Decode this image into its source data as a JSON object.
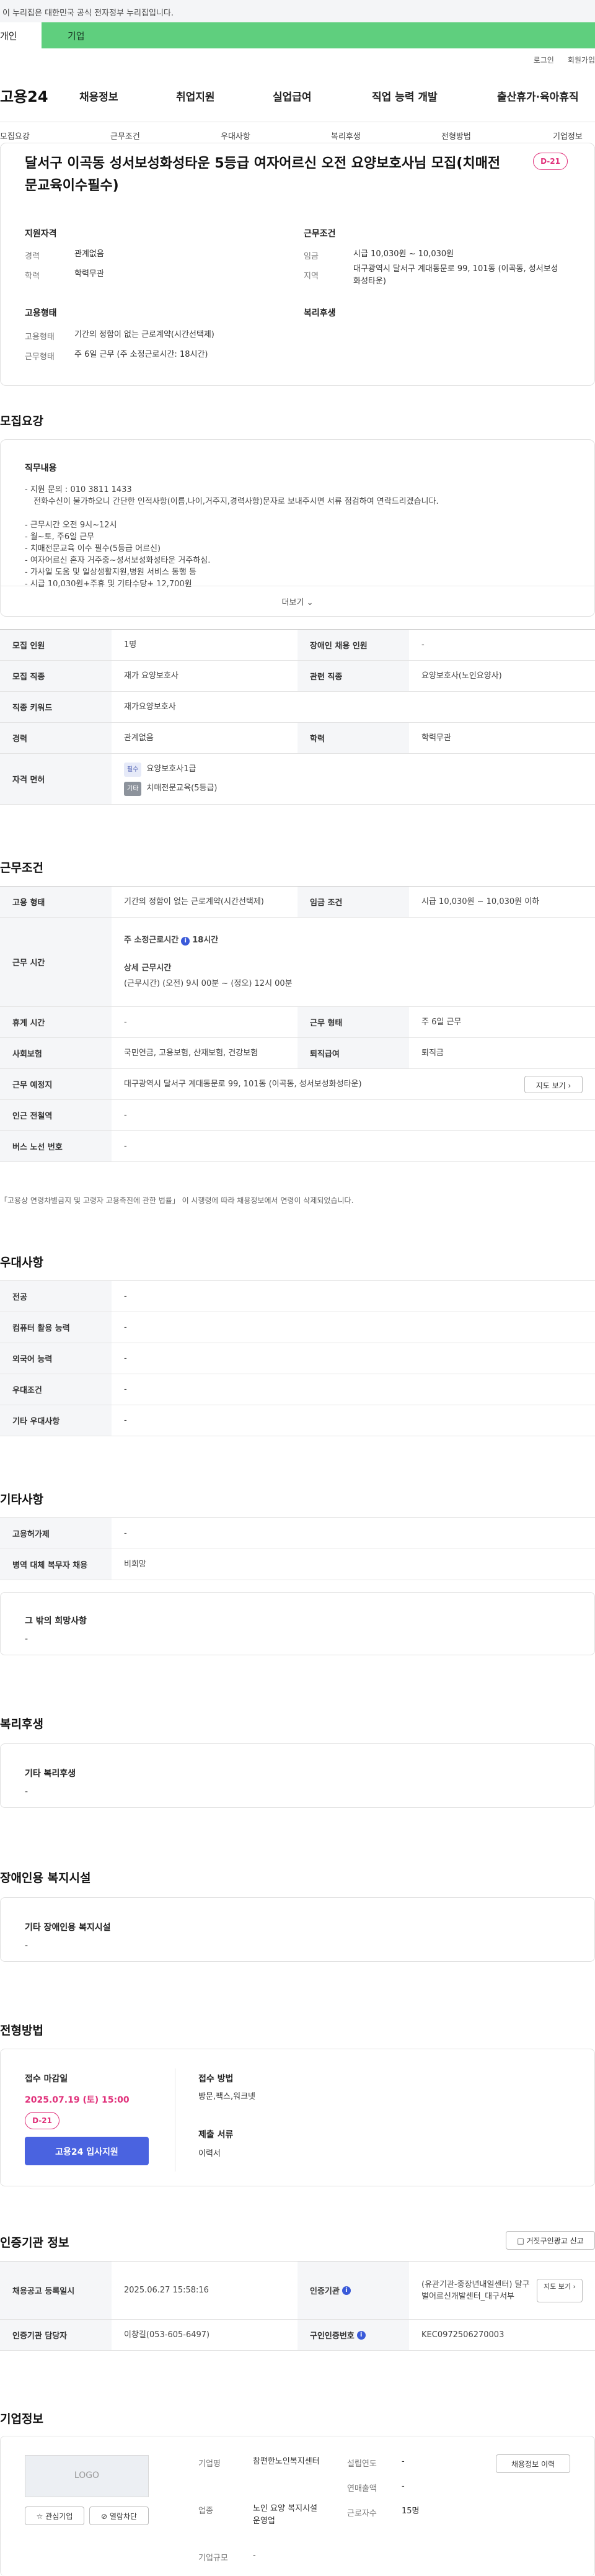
{
  "gov_banner": "이 누리집은 대한민국 공식 전자정부 누리집입니다.",
  "top_tabs": {
    "personal": "개인",
    "company": "기업"
  },
  "util": {
    "login": "로그인",
    "join": "회원가입"
  },
  "logo": "고용24",
  "gnb": [
    "채용정보",
    "취업지원",
    "실업급여",
    "직업 능력 개발",
    "출산휴가·육아휴직"
  ],
  "subnav": [
    "모집요강",
    "근무조건",
    "우대사항",
    "복리후생",
    "전형방법",
    "기업정보"
  ],
  "job": {
    "title": "달서구 이곡동 성서보성화성타운 5등급 여자어르신 오전 요양보호사님 모집(치매전문교육이수필수)",
    "dday": "D-21",
    "qual_h": "지원자격",
    "qual": [
      [
        "경력",
        "관계없음"
      ],
      [
        "학력",
        "학력무관"
      ]
    ],
    "cond_h": "근무조건",
    "cond": [
      [
        "임금",
        "시급 10,030원 ~ 10,030원"
      ],
      [
        "지역",
        "대구광역시 달서구 계대동문로 99, 101동 (이곡동, 성서보성화성타운)"
      ]
    ],
    "emp_h": "고용형태",
    "emp": [
      [
        "고용형태",
        "기간의 정함이 없는 근로계약(시간선택제)"
      ],
      [
        "근무형태",
        "주 6일 근무 (주 소정근로시간: 18시간)"
      ]
    ],
    "welfare_h": "복리후생"
  },
  "recruit": {
    "heading": "모집요강",
    "duty_h": "직무내용",
    "duty_lines": [
      "- 지원 문의 : 010 3811 1433",
      "  전화수신이 불가하오니 간단한 인적사항(이름,나이,거주지,경력사항)문자로 보내주시면 서류 점검하여 연락드리겠습니다.",
      "",
      "- 근무시간 오전 9시~12시",
      "- 월~토, 주6일 근무",
      "- 치매전문교육 이수 필수(5등급 어르신)",
      "- 여자어르신 혼자 거주중~성서보성화성타운 거주하심.",
      "- 가사일 도움 및 일상생활지원,병원 서비스 동행 등",
      "- 시급 10,030원+주휴 및 기타수당+ 12,700원"
    ],
    "more": "더보기",
    "rows": [
      {
        "k1": "모집 인원",
        "v1": "1명",
        "k2": "장애인 채용 인원",
        "v2": "-"
      },
      {
        "k1": "모집 직종",
        "v1": "재가 요양보호사",
        "k2": "관련 직종",
        "v2": "요양보호사(노인요양사)"
      },
      {
        "k1": "직종 키워드",
        "v1": "재가요양보호사"
      },
      {
        "k1": "경력",
        "v1": "관계없음",
        "k2": "학력",
        "v2": "학력무관"
      }
    ],
    "license_k": "자격 면허",
    "license_badge1": "필수",
    "license_v1": "요양보호사1급",
    "license_badge2": "기타",
    "license_v2": "치매전문교육(5등급)"
  },
  "work": {
    "heading": "근무조건",
    "emp_k": "고용 형태",
    "emp_v": "기간의 정함이 없는 근로계약(시간선택제)",
    "wage_k": "임금 조건",
    "wage_v": "시급 10,030원 ~ 10,030원 이하",
    "time_k": "근무 시간",
    "time_sub1": "주 소정근로시간",
    "time_sub1_v": "18시간",
    "time_sub2": "상세 근무시간",
    "time_sub2_v": "(근무시간) (오전) 9시 00분 ~ (정오) 12시 00분",
    "rest_k": "휴게 시간",
    "rest_v": "-",
    "shift_k": "근무 형태",
    "shift_v": "주 6일 근무",
    "ins_k": "사회보험",
    "ins_v": "국민연금, 고용보험, 산재보험, 건강보험",
    "sev_k": "퇴직급여",
    "sev_v": "퇴직금",
    "loc_k": "근무 예정지",
    "loc_v": "대구광역시 달서구 계대동문로 99, 101동 (이곡동, 성서보성화성타운)",
    "map_btn": "지도 보기",
    "subway_k": "인근 전철역",
    "subway_v": "-",
    "bus_k": "버스 노선 번호",
    "bus_v": "-",
    "note": "「고용상 연령차별금지 및 고령자 고용촉진에 관한 법률」 이 시행령에 따라 채용정보에서 연령이 삭제되었습니다."
  },
  "pref": {
    "heading": "우대사항",
    "rows": [
      [
        "전공",
        "-"
      ],
      [
        "컴퓨터 활용 능력",
        "-"
      ],
      [
        "외국어 능력",
        "-"
      ],
      [
        "우대조건",
        "-"
      ],
      [
        "기타 우대사항",
        "-"
      ]
    ]
  },
  "etc": {
    "heading": "기타사항",
    "rows": [
      [
        "고용허가제",
        "-"
      ],
      [
        "병역 대체 복무자 채용",
        "비희망"
      ]
    ],
    "hope_h": "그 밖의 희망사항",
    "hope_v": "-"
  },
  "welfare": {
    "heading": "복리후생",
    "box_h": "기타 복리후생",
    "box_v": "-"
  },
  "disab": {
    "heading": "장애인용 복지시설",
    "box_h": "기타 장애인용 복지시설",
    "box_v": "-"
  },
  "screen": {
    "heading": "전형방법",
    "deadline_h": "접수 마감일",
    "deadline_v": "2025.07.19 (토) 15:00",
    "dday": "D-21",
    "apply_btn": "고용24 입사지원",
    "method_h": "접수 방법",
    "method_v": "방문,팩스,워크넷",
    "docs_h": "제출 서류",
    "docs_v": "이력서"
  },
  "cert": {
    "heading": "인증기관 정보",
    "report_btn": "거짓구인광고 신고",
    "reg_k": "채용공고 등록일시",
    "reg_v": "2025.06.27 15:58:16",
    "org_k": "인증기관",
    "org_v": "(유관기관-중장년내일센터) 달구벌어르신개발센터_대구서부",
    "map_btn": "지도 보기",
    "mgr_k": "인증기관 담당자",
    "mgr_v": "이창길(053-605-6497)",
    "id_k": "구인인증번호",
    "id_v": "KEC0972506270003"
  },
  "company": {
    "heading": "기업정보",
    "logo_text": "LOGO",
    "fav_btn": "관심기업",
    "block_btn": "열람차단",
    "list_btn": "채용정보 이력",
    "name_k": "기업명",
    "name_v": "참편한노인복지센터",
    "biz_k": "업종",
    "biz_v": "노인 요양 복지시설 운영업",
    "size_k": "기업규모",
    "size_v": "-",
    "est_k": "설립연도",
    "est_v": "-",
    "sales_k": "연매출액",
    "sales_v": "-",
    "emp_k": "근로자수",
    "emp_v": "15명"
  },
  "colors": {
    "accent_green": "#5fcf7e",
    "primary_blue": "#4a63e0",
    "dday_pink": "#e0307a",
    "deadline_red": "#e0307a"
  }
}
